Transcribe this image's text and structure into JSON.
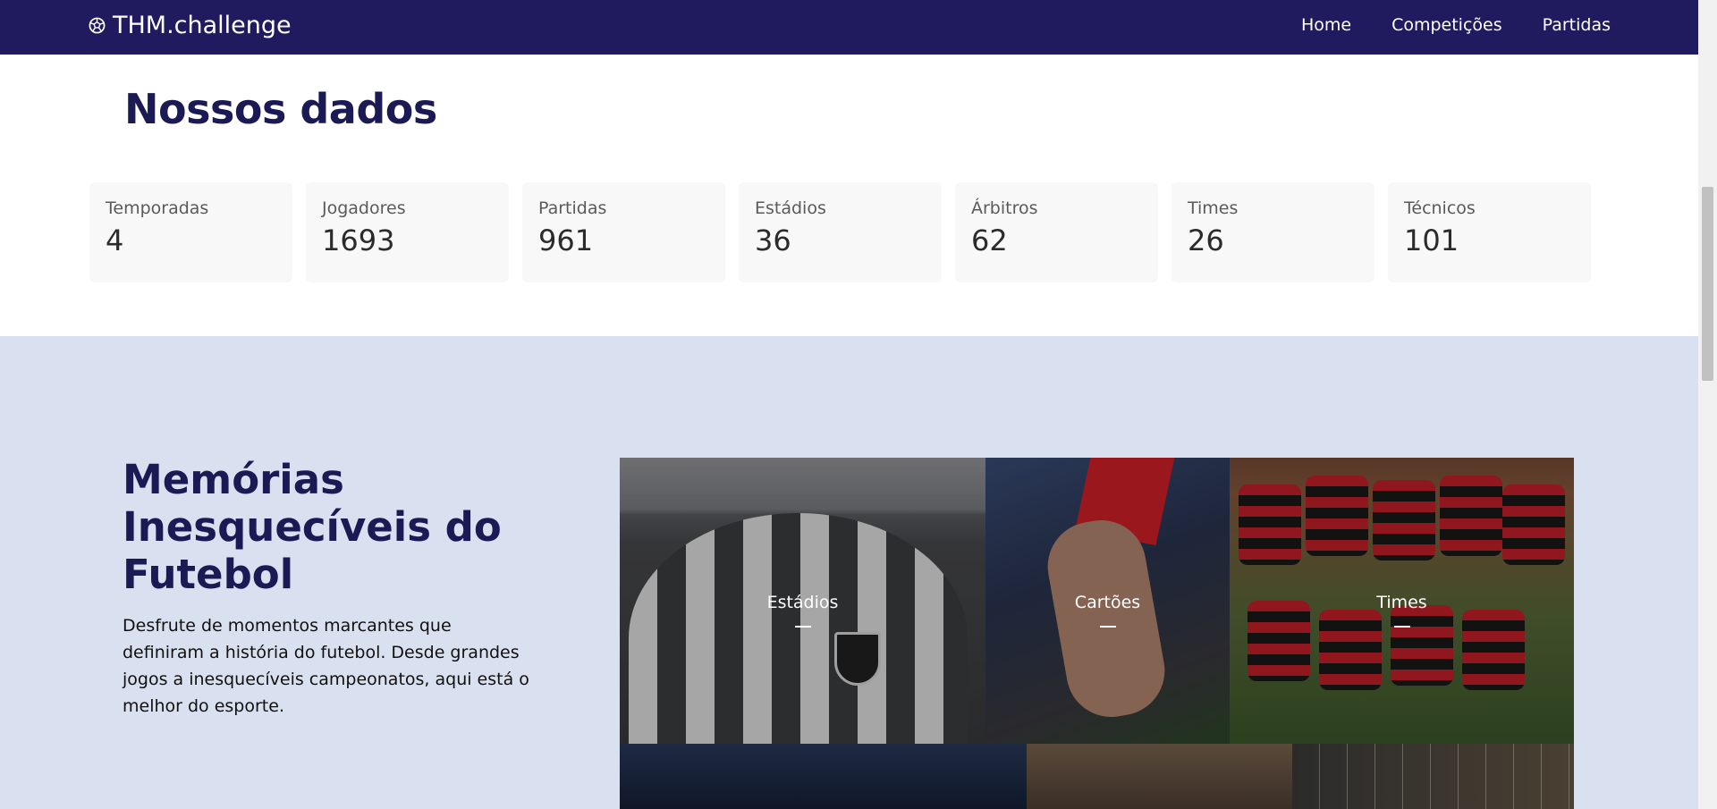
{
  "nav": {
    "brand": "THM.challenge",
    "links": [
      "Home",
      "Competições",
      "Partidas"
    ]
  },
  "stats_section": {
    "title": "Nossos dados",
    "items": [
      {
        "label": "Temporadas",
        "value": "4"
      },
      {
        "label": "Jogadores",
        "value": "1693"
      },
      {
        "label": "Partidas",
        "value": "961"
      },
      {
        "label": "Estádios",
        "value": "36"
      },
      {
        "label": "Árbitros",
        "value": "62"
      },
      {
        "label": "Times",
        "value": "26"
      },
      {
        "label": "Técnicos",
        "value": "101"
      }
    ]
  },
  "memories": {
    "title": "Memórias Inesquecíveis do Futebol",
    "description": "Desfrute de momentos marcantes que definiram a história do futebol. Desde grandes jogos a inesquecíveis campeonatos, aqui está o melhor do esporte.",
    "tiles": [
      {
        "label": "Estádios"
      },
      {
        "label": "Cartões"
      },
      {
        "label": "Times"
      }
    ]
  },
  "colors": {
    "navbar": "#201a5e",
    "heading": "#1b1a55",
    "memories_bg": "#d9e0ef",
    "card_bg": "#f8f8f8"
  }
}
